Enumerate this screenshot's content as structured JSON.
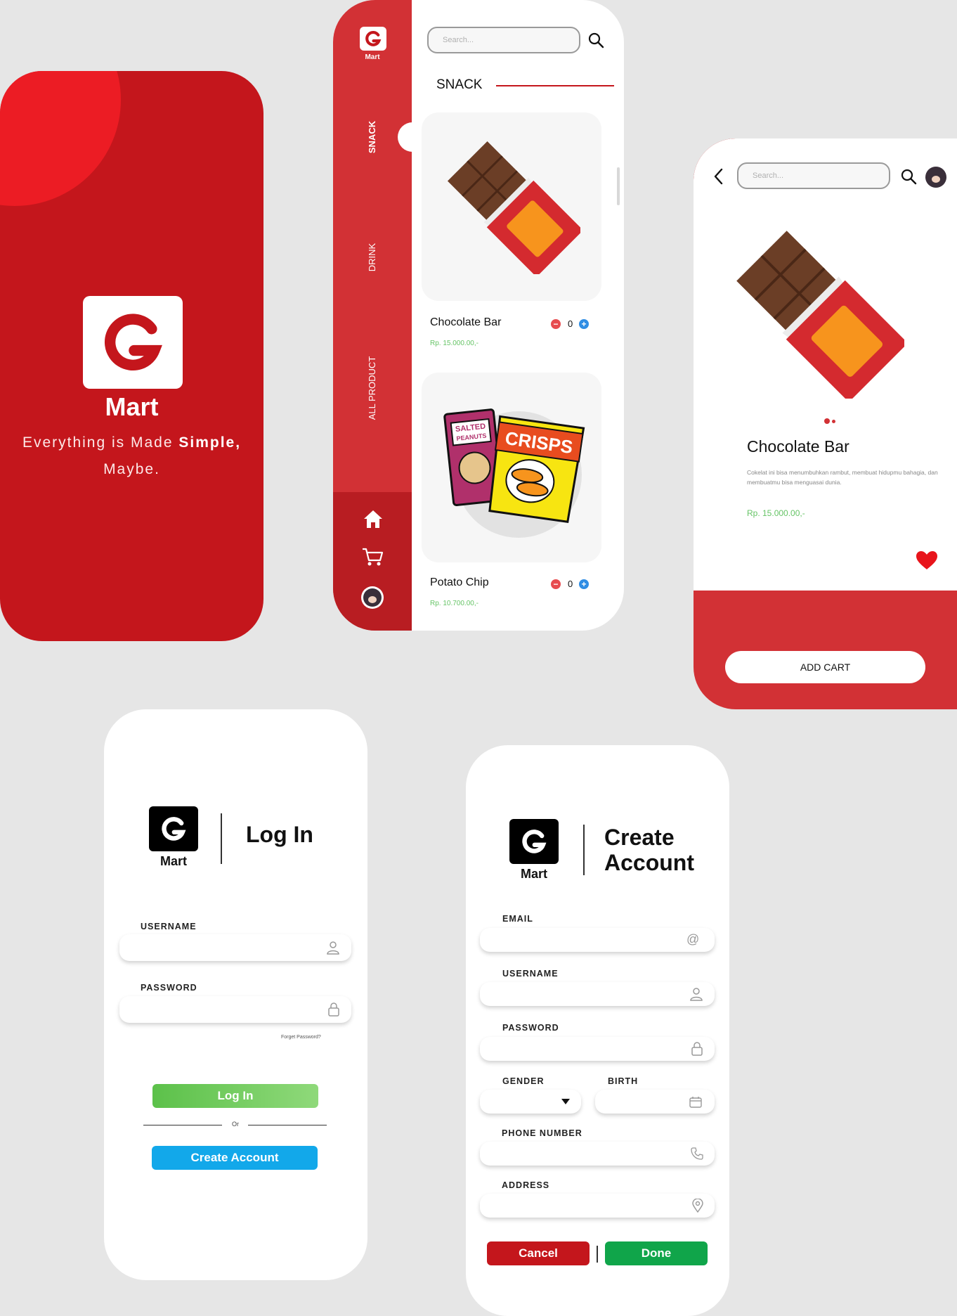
{
  "splash": {
    "brand": "Mart",
    "tagline_plain": "Everything is Made ",
    "tagline_bold": "Simple,",
    "tagline_line2": "Maybe."
  },
  "catalog": {
    "logo_label": "Mart",
    "search_placeholder": "Search...",
    "section_title": "SNACK",
    "side_tabs": [
      "SNACK",
      "DRINK",
      "ALL PRODUCT"
    ],
    "products": [
      {
        "name": "Chocolate Bar",
        "price": "Rp. 15.000.00,-",
        "qty": "0"
      },
      {
        "name": "Potato Chip",
        "price": "Rp. 10.700.00,-",
        "qty": "0",
        "bag1_text": "SALTED PEANUTS",
        "bag2_text": "CRISPS"
      }
    ]
  },
  "detail": {
    "search_placeholder": "Search...",
    "name": "Chocolate Bar",
    "description": "Cokelat ini bisa menumbuhkan rambut, membuat hidupmu bahagia, dan membuatmu bisa menguasai dunia.",
    "price": "Rp. 15.000.00,-",
    "add_cart": "ADD CART"
  },
  "login": {
    "logo_label": "Mart",
    "title": "Log In",
    "username_label": "USERNAME",
    "password_label": "PASSWORD",
    "forgot": "Forget Password?",
    "login_button": "Log In",
    "or": "Or",
    "create_button": "Create Account"
  },
  "signup": {
    "logo_label": "Mart",
    "title_line1": "Create",
    "title_line2": "Account",
    "email_label": "EMAIL",
    "username_label": "USERNAME",
    "password_label": "PASSWORD",
    "gender_label": "GENDER",
    "birth_label": "BIRTH",
    "phone_label": "PHONE NUMBER",
    "address_label": "ADDRESS",
    "cancel": "Cancel",
    "done": "Done"
  },
  "colors": {
    "brand_red": "#c4161c",
    "accent_red": "#d23135",
    "price_green": "#66c466",
    "login_green": "#6cc65a",
    "create_blue": "#12a8ea",
    "done_green": "#10a54a"
  }
}
